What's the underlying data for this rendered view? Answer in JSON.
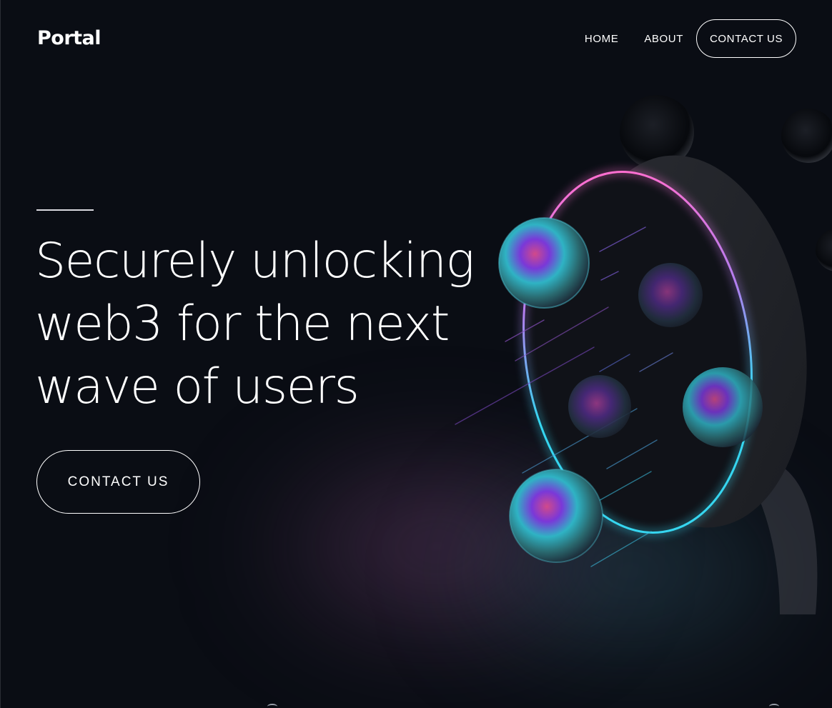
{
  "header": {
    "logo": "Portal",
    "nav": {
      "home": "HOME",
      "about": "ABOUT",
      "contact": "CONTACT US"
    }
  },
  "hero": {
    "headline_lines": [
      "Securely unlocking",
      "web3 for the next",
      "wave of users"
    ],
    "cta": "CONTACT US"
  },
  "colors": {
    "background": "#0a0d14",
    "ring_pink": "#ff6fd0",
    "ring_cyan": "#36d6f0",
    "text": "#ffffff"
  }
}
